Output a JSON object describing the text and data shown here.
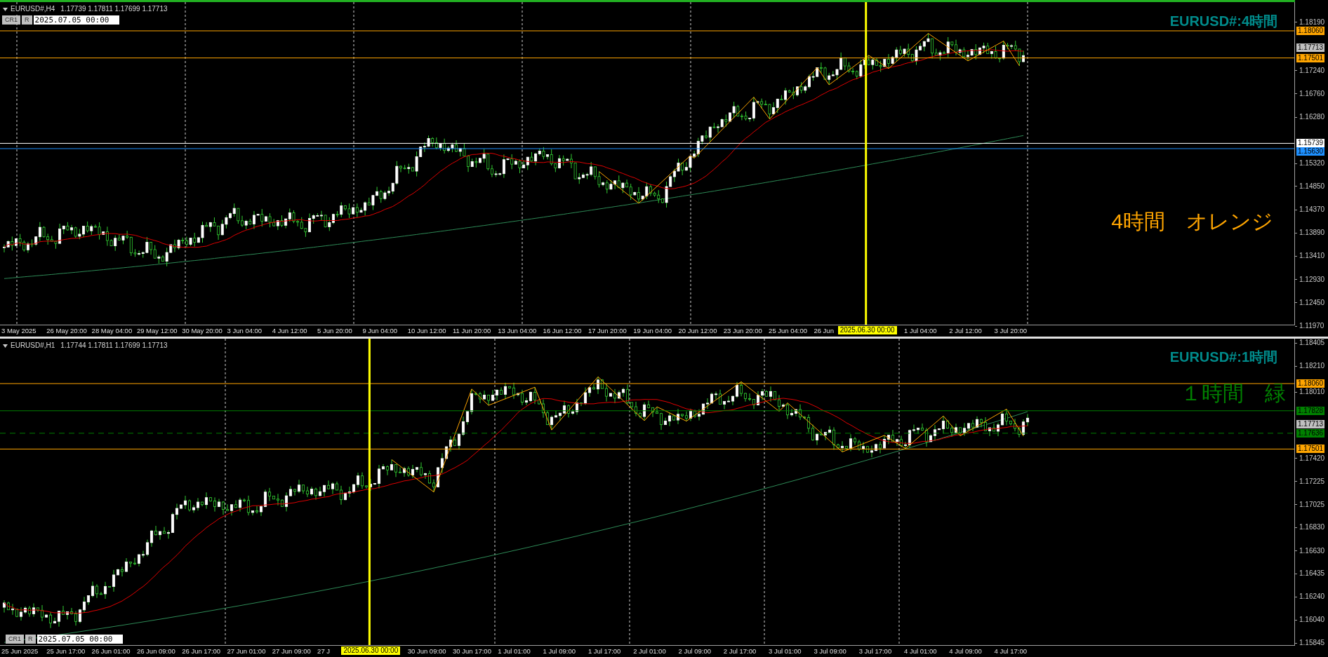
{
  "charts": [
    {
      "header": {
        "symbol": "EURUSD#,H4",
        "ohlc": "1.17739 1.17811 1.17699 1.17713"
      },
      "controls": {
        "buttons": [
          "CR1",
          "R"
        ],
        "date": "2025.07.05 00:00"
      },
      "title": "EURUSD#:4時間",
      "note": {
        "text": "4時間　オレンジ",
        "color": "#ffa500"
      },
      "price_ticks": [
        "1.18190",
        "1.17240",
        "1.16760",
        "1.16280",
        "1.15320",
        "1.14850",
        "1.14370",
        "1.13890",
        "1.13410",
        "1.12930",
        "1.12450",
        "1.11970"
      ],
      "price_lines": [
        {
          "label": "1.18060",
          "kind": "solid",
          "color": "#ffa500"
        },
        {
          "label": "1.17713",
          "kind": "label-only",
          "color": "#c0c0c0"
        },
        {
          "label": "1.17501",
          "kind": "solid",
          "color": "#ffa500"
        },
        {
          "label": "1.15739",
          "kind": "solid",
          "color": "#ffffff"
        },
        {
          "label": "1.15630",
          "kind": "solid",
          "color": "#1e90ff"
        }
      ],
      "time_labels": [
        {
          "text": "3 May 2025",
          "selected": false
        },
        {
          "text": "26 May 20:00",
          "selected": false
        },
        {
          "text": "28 May 04:00",
          "selected": false
        },
        {
          "text": "29 May 12:00",
          "selected": false
        },
        {
          "text": "30 May 20:00",
          "selected": false
        },
        {
          "text": "3 Jun 04:00",
          "selected": false
        },
        {
          "text": "4 Jun 12:00",
          "selected": false
        },
        {
          "text": "5 Jun 20:00",
          "selected": false
        },
        {
          "text": "9 Jun 04:00",
          "selected": false
        },
        {
          "text": "10 Jun 12:00",
          "selected": false
        },
        {
          "text": "11 Jun 20:00",
          "selected": false
        },
        {
          "text": "13 Jun 04:00",
          "selected": false
        },
        {
          "text": "16 Jun 12:00",
          "selected": false
        },
        {
          "text": "17 Jun 20:00",
          "selected": false
        },
        {
          "text": "19 Jun 04:00",
          "selected": false
        },
        {
          "text": "20 Jun 12:00",
          "selected": false
        },
        {
          "text": "23 Jun 20:00",
          "selected": false
        },
        {
          "text": "25 Jun 04:00",
          "selected": false
        },
        {
          "text": "26 Jun",
          "selected": false
        },
        {
          "text": "2025.06.30 00:00",
          "selected": true
        },
        {
          "text": "1 Jul 04:00",
          "selected": false
        },
        {
          "text": "2 Jul 12:00",
          "selected": false
        },
        {
          "text": "3 Jul 20:00",
          "selected": false
        }
      ]
    },
    {
      "header": {
        "symbol": "EURUSD#,H1",
        "ohlc": "1.17744 1.17811 1.17699 1.17713"
      },
      "controls": {
        "buttons": [
          "CR1",
          "R"
        ],
        "date": "2025.07.05 00:00"
      },
      "title": "EURUSD#:1時間",
      "note": {
        "text": "１時間　緑",
        "color": "#008000"
      },
      "price_ticks": [
        "1.18405",
        "1.18210",
        "1.18010",
        "1.17420",
        "1.17225",
        "1.17025",
        "1.16830",
        "1.16630",
        "1.16435",
        "1.16240",
        "1.16040",
        "1.15845"
      ],
      "price_lines": [
        {
          "label": "1.18060",
          "kind": "solid",
          "color": "#ffa500"
        },
        {
          "label": "1.17828",
          "kind": "solid",
          "color": "#008000"
        },
        {
          "label": "1.17713",
          "kind": "label-only",
          "color": "#c0c0c0"
        },
        {
          "label": "1.17636",
          "kind": "dashed",
          "color": "#008000"
        },
        {
          "label": "1.17501",
          "kind": "solid",
          "color": "#ffa500"
        }
      ],
      "time_labels": [
        {
          "text": "25 Jun 2025",
          "selected": false
        },
        {
          "text": "25 Jun 17:00",
          "selected": false
        },
        {
          "text": "26 Jun 01:00",
          "selected": false
        },
        {
          "text": "26 Jun 09:00",
          "selected": false
        },
        {
          "text": "26 Jun 17:00",
          "selected": false
        },
        {
          "text": "27 Jun 01:00",
          "selected": false
        },
        {
          "text": "27 Jun 09:00",
          "selected": false
        },
        {
          "text": "27 J",
          "selected": false
        },
        {
          "text": "2025.06.30 00:00",
          "selected": true
        },
        {
          "text": "30 Jun 09:00",
          "selected": false
        },
        {
          "text": "30 Jun 17:00",
          "selected": false
        },
        {
          "text": "1 Jul 01:00",
          "selected": false
        },
        {
          "text": "1 Jul 09:00",
          "selected": false
        },
        {
          "text": "1 Jul 17:00",
          "selected": false
        },
        {
          "text": "2 Jul 01:00",
          "selected": false
        },
        {
          "text": "2 Jul 09:00",
          "selected": false
        },
        {
          "text": "2 Jul 17:00",
          "selected": false
        },
        {
          "text": "3 Jul 01:00",
          "selected": false
        },
        {
          "text": "3 Jul 09:00",
          "selected": false
        },
        {
          "text": "3 Jul 17:00",
          "selected": false
        },
        {
          "text": "4 Jul 01:00",
          "selected": false
        },
        {
          "text": "4 Jul 09:00",
          "selected": false
        },
        {
          "text": "4 Jul 17:00",
          "selected": false
        }
      ]
    }
  ]
}
